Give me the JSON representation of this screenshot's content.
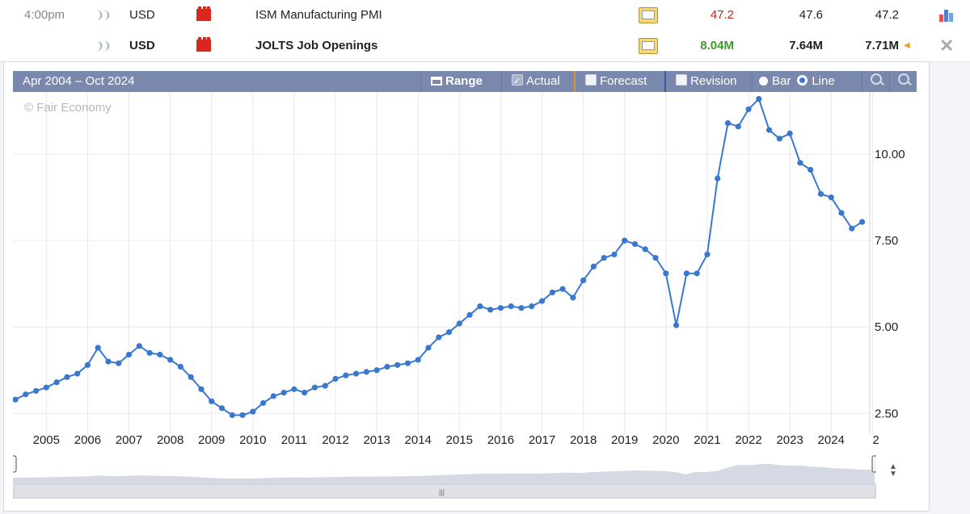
{
  "rows": [
    {
      "time": "4:00pm",
      "impact_icon": "impact-icon",
      "currency": "USD",
      "flag_icon": "us-flag-icon",
      "event": "ISM Manufacturing PMI",
      "actual": "47.2",
      "forecast": "47.6",
      "previous": "47.2",
      "actual_color": "#c0251b",
      "bold": false
    },
    {
      "time": "",
      "impact_icon": "impact-icon",
      "currency": "USD",
      "flag_icon": "us-flag-icon",
      "event": "JOLTS Job Openings",
      "actual": "8.04M",
      "forecast": "7.64M",
      "previous": "7.71M",
      "actual_color": "#3d9a2a",
      "bold": true
    }
  ],
  "toolbar": {
    "range_title": "Apr 2004 – Oct 2024",
    "range_label": "Range",
    "actual_label": "Actual",
    "forecast_label": "Forecast",
    "revision_label": "Revision",
    "bar_label": "Bar",
    "line_label": "Line",
    "actual_checked": true,
    "forecast_checked": false,
    "revision_checked": false,
    "selected_type": "line"
  },
  "watermark": "© Fair Economy",
  "colors": {
    "series": "#3a78d0",
    "toolbar": "#7b88ad",
    "navigator": "#d5d9e3",
    "grid": "#e6e9ef"
  },
  "chart_data": {
    "type": "line",
    "x_axis": "date",
    "xlim": [
      "2004-04",
      "2024-10"
    ],
    "ylim": [
      1.9,
      11.8
    ],
    "y_ticks": [
      "2.50",
      "5.00",
      "7.50",
      "10.00"
    ],
    "x_ticks": [
      "2005",
      "2006",
      "2007",
      "2008",
      "2009",
      "2010",
      "2011",
      "2012",
      "2013",
      "2014",
      "2015",
      "2016",
      "2017",
      "2018",
      "2019",
      "2020",
      "2021",
      "2022",
      "2023",
      "2024",
      "2"
    ],
    "grid": true,
    "y_axis_position": "right",
    "series": [
      {
        "unit": "M",
        "points": [
          [
            "2004-04",
            2.9
          ],
          [
            "2004-07",
            3.05
          ],
          [
            "2004-10",
            3.15
          ],
          [
            "2005-01",
            3.25
          ],
          [
            "2005-04",
            3.4
          ],
          [
            "2005-07",
            3.55
          ],
          [
            "2005-10",
            3.65
          ],
          [
            "2006-01",
            3.9
          ],
          [
            "2006-04",
            4.4
          ],
          [
            "2006-07",
            4.0
          ],
          [
            "2006-10",
            3.95
          ],
          [
            "2007-01",
            4.2
          ],
          [
            "2007-04",
            4.45
          ],
          [
            "2007-07",
            4.25
          ],
          [
            "2007-10",
            4.2
          ],
          [
            "2008-01",
            4.05
          ],
          [
            "2008-04",
            3.85
          ],
          [
            "2008-07",
            3.55
          ],
          [
            "2008-10",
            3.2
          ],
          [
            "2009-01",
            2.85
          ],
          [
            "2009-04",
            2.65
          ],
          [
            "2009-07",
            2.45
          ],
          [
            "2009-10",
            2.45
          ],
          [
            "2010-01",
            2.55
          ],
          [
            "2010-04",
            2.8
          ],
          [
            "2010-07",
            3.0
          ],
          [
            "2010-10",
            3.1
          ],
          [
            "2011-01",
            3.2
          ],
          [
            "2011-04",
            3.1
          ],
          [
            "2011-07",
            3.25
          ],
          [
            "2011-10",
            3.3
          ],
          [
            "2012-01",
            3.5
          ],
          [
            "2012-04",
            3.6
          ],
          [
            "2012-07",
            3.65
          ],
          [
            "2012-10",
            3.7
          ],
          [
            "2013-01",
            3.75
          ],
          [
            "2013-04",
            3.85
          ],
          [
            "2013-07",
            3.9
          ],
          [
            "2013-10",
            3.95
          ],
          [
            "2014-01",
            4.05
          ],
          [
            "2014-04",
            4.4
          ],
          [
            "2014-07",
            4.7
          ],
          [
            "2014-10",
            4.85
          ],
          [
            "2015-01",
            5.1
          ],
          [
            "2015-04",
            5.35
          ],
          [
            "2015-07",
            5.6
          ],
          [
            "2015-10",
            5.5
          ],
          [
            "2016-01",
            5.55
          ],
          [
            "2016-04",
            5.6
          ],
          [
            "2016-07",
            5.55
          ],
          [
            "2016-10",
            5.6
          ],
          [
            "2017-01",
            5.75
          ],
          [
            "2017-04",
            6.0
          ],
          [
            "2017-07",
            6.1
          ],
          [
            "2017-10",
            5.85
          ],
          [
            "2018-01",
            6.35
          ],
          [
            "2018-04",
            6.75
          ],
          [
            "2018-07",
            7.0
          ],
          [
            "2018-10",
            7.1
          ],
          [
            "2019-01",
            7.5
          ],
          [
            "2019-04",
            7.4
          ],
          [
            "2019-07",
            7.25
          ],
          [
            "2019-10",
            7.0
          ],
          [
            "2020-01",
            6.55
          ],
          [
            "2020-04",
            5.05
          ],
          [
            "2020-07",
            6.55
          ],
          [
            "2020-10",
            6.55
          ],
          [
            "2021-01",
            7.1
          ],
          [
            "2021-04",
            9.3
          ],
          [
            "2021-07",
            10.9
          ],
          [
            "2021-10",
            10.8
          ],
          [
            "2022-01",
            11.3
          ],
          [
            "2022-04",
            11.6
          ],
          [
            "2022-07",
            10.7
          ],
          [
            "2022-10",
            10.45
          ],
          [
            "2023-01",
            10.6
          ],
          [
            "2023-04",
            9.75
          ],
          [
            "2023-07",
            9.55
          ],
          [
            "2023-10",
            8.85
          ],
          [
            "2024-01",
            8.75
          ],
          [
            "2024-04",
            8.3
          ],
          [
            "2024-07",
            7.85
          ],
          [
            "2024-10",
            8.04
          ]
        ]
      }
    ]
  }
}
